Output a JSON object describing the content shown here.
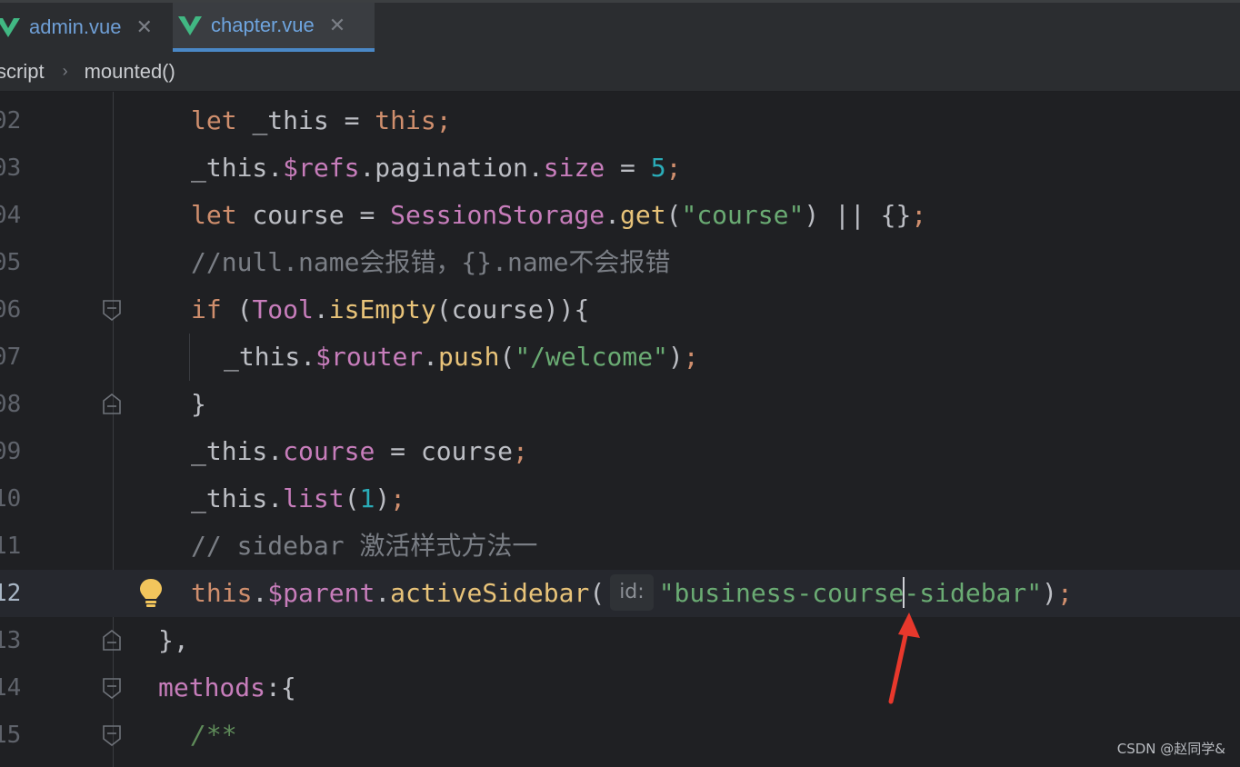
{
  "tabs": [
    {
      "label": "admin.vue",
      "active": false
    },
    {
      "label": "chapter.vue",
      "active": true
    }
  ],
  "breadcrumb": [
    "script",
    "mounted()"
  ],
  "lines": [
    {
      "num": "02",
      "tokens": [
        [
          "let ",
          "kw"
        ],
        [
          "_this = ",
          ""
        ],
        [
          "this",
          "kw"
        ],
        [
          ";",
          "kw"
        ]
      ]
    },
    {
      "num": "03",
      "tokens": [
        [
          "_this.",
          ""
        ],
        [
          "$refs",
          "pr"
        ],
        [
          ".pagination.",
          ""
        ],
        [
          "size",
          "pr"
        ],
        [
          " = ",
          ""
        ],
        [
          "5",
          "num"
        ],
        [
          ";",
          "kw"
        ]
      ]
    },
    {
      "num": "04",
      "tokens": [
        [
          "let ",
          "kw"
        ],
        [
          "course = ",
          ""
        ],
        [
          "SessionStorage",
          "cls"
        ],
        [
          ".",
          ""
        ],
        [
          "get",
          "fn"
        ],
        [
          "(",
          ""
        ],
        [
          "\"course\"",
          "str"
        ],
        [
          ") || {}",
          ""
        ],
        [
          ";",
          "kw"
        ]
      ]
    },
    {
      "num": "05",
      "tokens": [
        [
          "//null.name会报错，{}.name不会报错",
          "cm"
        ]
      ]
    },
    {
      "num": "06",
      "tokens": [
        [
          "if ",
          "kw"
        ],
        [
          "(",
          ""
        ],
        [
          "Tool",
          "cls"
        ],
        [
          ".",
          ""
        ],
        [
          "isEmpty",
          "fn"
        ],
        [
          "(course)){",
          ""
        ]
      ]
    },
    {
      "num": "07",
      "tokens": [
        [
          "_this.",
          ""
        ],
        [
          "$router",
          "pr"
        ],
        [
          ".",
          ""
        ],
        [
          "push",
          "fn"
        ],
        [
          "(",
          ""
        ],
        [
          "\"/welcome\"",
          "str"
        ],
        [
          ")",
          ""
        ],
        [
          ";",
          "kw"
        ]
      ]
    },
    {
      "num": "08",
      "tokens": [
        [
          "}",
          ""
        ]
      ]
    },
    {
      "num": "09",
      "tokens": [
        [
          "_this.",
          ""
        ],
        [
          "course",
          "pr"
        ],
        [
          " = course",
          ""
        ],
        [
          ";",
          "kw"
        ]
      ]
    },
    {
      "num": "10",
      "tokens": [
        [
          "_this.",
          ""
        ],
        [
          "list",
          "pr"
        ],
        [
          "(",
          ""
        ],
        [
          "1",
          "num"
        ],
        [
          ")",
          ""
        ],
        [
          ";",
          "kw"
        ]
      ]
    },
    {
      "num": "11",
      "tokens": [
        [
          "// sidebar 激活样式方法一",
          "cm"
        ]
      ]
    },
    {
      "num": "12",
      "tokens": [
        [
          "this",
          "kw"
        ],
        [
          ".",
          ""
        ],
        [
          "$parent",
          "pr"
        ],
        [
          ".",
          ""
        ],
        [
          "activeSidebar",
          "fn"
        ],
        [
          "(",
          ""
        ]
      ],
      "hint": "id:",
      "after": [
        [
          "\"business-course",
          "str"
        ],
        [
          "|caret",
          ""
        ],
        [
          "-sidebar\"",
          "str"
        ],
        [
          ")",
          ""
        ],
        [
          ";",
          "kw"
        ]
      ]
    },
    {
      "num": "13",
      "tokens": [
        [
          "},",
          ""
        ]
      ]
    },
    {
      "num": "14",
      "tokens": [
        [
          "methods",
          "pr"
        ],
        [
          ":{",
          ""
        ]
      ]
    },
    {
      "num": "15",
      "tokens": [
        [
          "/**",
          "doc"
        ]
      ]
    }
  ],
  "watermark": "CSDN @赵同学&",
  "icons": {
    "vue": "vue-logo-icon",
    "close": "close-icon",
    "fold": "fold-marker-icon",
    "bulb": "lightbulb-icon",
    "arrow": "red-arrow-annotation"
  }
}
